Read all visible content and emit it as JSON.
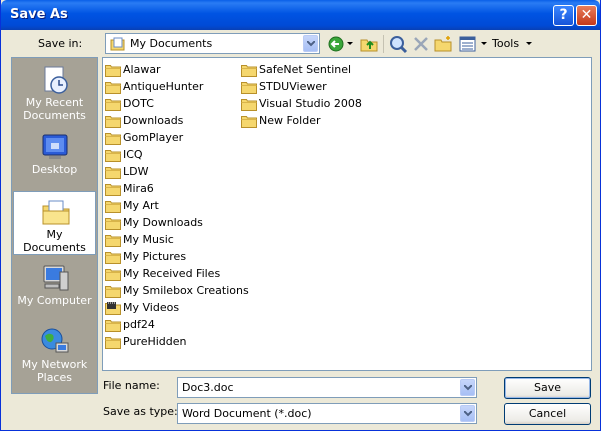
{
  "window": {
    "title": "Save As"
  },
  "titlebar": {
    "help_label": "?",
    "close_label": "✕"
  },
  "save_in": {
    "label": "Save in:",
    "value": "My Documents"
  },
  "toolbar": {
    "tools_label": "Tools"
  },
  "places": [
    {
      "label": "My Recent Documents",
      "line1": "My Recent",
      "line2": "Documents",
      "icon": "recent-documents-icon"
    },
    {
      "label": "Desktop",
      "line1": "Desktop",
      "line2": "",
      "icon": "desktop-icon"
    },
    {
      "label": "My Documents",
      "line1": "My Documents",
      "line2": "",
      "icon": "my-documents-icon",
      "selected": true
    },
    {
      "label": "My Computer",
      "line1": "My Computer",
      "line2": "",
      "icon": "my-computer-icon"
    },
    {
      "label": "My Network Places",
      "line1": "My Network",
      "line2": "Places",
      "icon": "network-places-icon"
    }
  ],
  "files_col1": [
    "Alawar",
    "AntiqueHunter",
    "DOTC",
    "Downloads",
    "GomPlayer",
    "ICQ",
    "LDW",
    "Mira6",
    "My Art",
    "My Downloads",
    "My Music",
    "My Pictures",
    "My Received Files",
    "My Smilebox Creations",
    "My Videos",
    "pdf24",
    "PureHidden"
  ],
  "files_col2": [
    "SafeNet Sentinel",
    "STDUViewer",
    "Visual Studio 2008",
    "New Folder"
  ],
  "file_name": {
    "label": "File name:",
    "value": "Doc3.doc"
  },
  "save_as_type": {
    "label": "Save as type:",
    "value": "Word Document (*.doc)"
  },
  "buttons": {
    "save": "Save",
    "cancel": "Cancel"
  },
  "colors": {
    "title_blue": "#0054e3",
    "dialog_bg": "#ece9d8",
    "places_bg": "#a6a296",
    "folder": "#f5d76e"
  }
}
